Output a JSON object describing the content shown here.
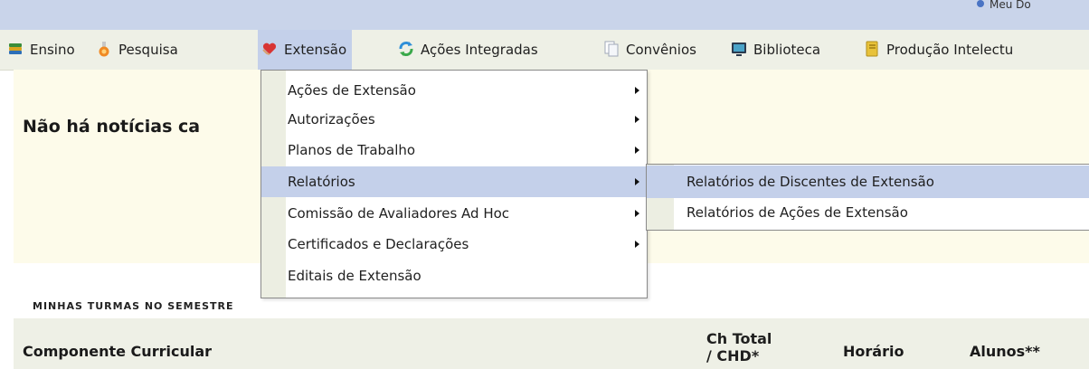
{
  "topbar": {
    "link_text": "Meu Do"
  },
  "menubar": {
    "items": [
      {
        "label": "Ensino",
        "icon": "book-stack-icon"
      },
      {
        "label": "Pesquisa",
        "icon": "flask-icon"
      },
      {
        "label": "Extensão",
        "icon": "heart-hands-icon"
      },
      {
        "label": "Ações Integradas",
        "icon": "recycle-icon"
      },
      {
        "label": "Convênios",
        "icon": "document-copy-icon"
      },
      {
        "label": "Biblioteca",
        "icon": "monitor-icon"
      },
      {
        "label": "Produção Intelectu",
        "icon": "notebook-icon"
      }
    ],
    "active": "Extensão"
  },
  "content": {
    "no_news": "Não há notícias ca"
  },
  "extensao_menu": {
    "items": [
      {
        "label": "Ações de Extensão",
        "has_submenu": true
      },
      {
        "label": "Autorizações",
        "has_submenu": true
      },
      {
        "label": "Planos de Trabalho",
        "has_submenu": true
      },
      {
        "label": "Relatórios",
        "has_submenu": true
      },
      {
        "label": "Comissão de Avaliadores Ad Hoc",
        "has_submenu": true
      },
      {
        "label": "Certificados e Declarações",
        "has_submenu": true
      },
      {
        "label": "Editais de Extensão",
        "has_submenu": false
      }
    ],
    "highlighted": "Relatórios"
  },
  "relatorios_submenu": {
    "items": [
      {
        "label": "Relatórios de Discentes de Extensão"
      },
      {
        "label": "Relatórios de Ações de Extensão"
      }
    ],
    "highlighted": "Relatórios de Discentes de Extensão"
  },
  "turmas": {
    "section_title": "Minhas turmas no semestre",
    "headers": {
      "componente": "Componente Curricular",
      "ch_line1": "Ch Total",
      "ch_line2": "/ CHD*",
      "horario": "Horário",
      "alunos": "Alunos**"
    }
  },
  "colors": {
    "topbar": "#c9d4ea",
    "menubar": "#eef0e6",
    "highlight": "#c4d0ea",
    "content_bg": "#fdfbea"
  }
}
